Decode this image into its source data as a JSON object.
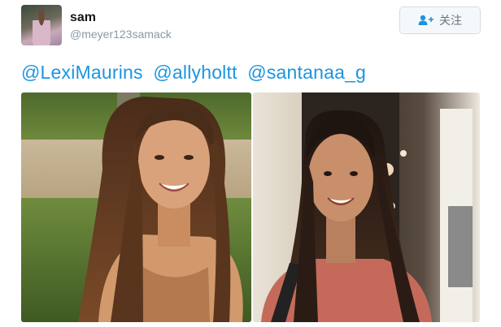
{
  "user": {
    "display_name": "sam",
    "handle": "@meyer123samack",
    "avatar_icon": "user-avatar-photo"
  },
  "follow_button": {
    "label": "关注",
    "icon": "add-user-icon"
  },
  "tweet": {
    "mentions": [
      "@LexiMaurins",
      "@allyholtt",
      "@santanaa_g"
    ]
  },
  "media": {
    "photo_count": 2,
    "photos": [
      "photo-outdoor-smiling-girl",
      "photo-mall-smiling-girl"
    ]
  },
  "colors": {
    "link": "#1b95e0",
    "name": "#14171a",
    "handle": "#8899a6"
  }
}
